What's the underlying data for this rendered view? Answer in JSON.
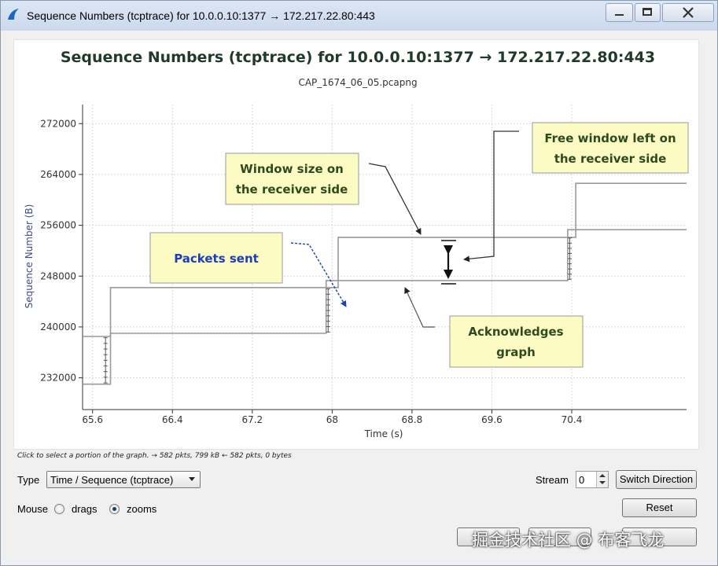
{
  "window": {
    "title": "Sequence Numbers (tcptrace) for 10.0.0.10:1377 → 172.217.22.80:443"
  },
  "chart_data": {
    "type": "line",
    "title": "Sequence Numbers (tcptrace) for 10.0.0.10:1377 → 172.217.22.80:443",
    "subtitle": "CAP_1674_06_05.pcapng",
    "xlabel": "Time (s)",
    "ylabel": "Sequence Number (B)",
    "xlim": [
      65.5,
      71.55
    ],
    "ylim": [
      227000,
      275000
    ],
    "xticks": [
      65.6,
      66.4,
      67.2,
      68,
      68.8,
      69.6,
      70.4
    ],
    "xtick_labels": [
      "65.6",
      "66.4",
      "67.2",
      "68",
      "68.8",
      "69.6",
      "70.4"
    ],
    "yticks": [
      232000,
      240000,
      248000,
      256000,
      264000,
      272000
    ],
    "ytick_labels": [
      "232000",
      "240000",
      "248000",
      "256000",
      "264000",
      "272000"
    ],
    "grid": true,
    "series": [
      {
        "color": "#9a9a9a",
        "x": [
          65.5,
          65.78,
          65.78,
          67.94,
          67.94,
          70.36,
          70.36,
          71.55
        ],
        "y": [
          231000,
          231000,
          239000,
          239000,
          247300,
          247300,
          255300,
          255300
        ]
      },
      {
        "color": "#9a9a9a",
        "x": [
          65.5,
          65.78,
          65.78,
          68.06,
          68.06,
          70.44,
          70.44,
          71.55
        ],
        "y": [
          238500,
          238500,
          246200,
          246200,
          254100,
          254100,
          262600,
          262600
        ]
      }
    ],
    "packet_bursts": [
      {
        "x": 65.73,
        "y0": 231200,
        "y1": 238300
      },
      {
        "x": 67.96,
        "y0": 239200,
        "y1": 246000
      },
      {
        "x": 70.38,
        "y0": 247500,
        "y1": 254000
      }
    ],
    "annotations": [
      {
        "text": "Window  size on\nthe receiver side"
      },
      {
        "text": "Free window  left on\nthe receiver side"
      },
      {
        "text": "Packets sent"
      },
      {
        "text": "Acknowledges\ngraph"
      }
    ]
  },
  "status": {
    "text": "Click to select a portion of the graph. → 582 pkts, 799 kB ← 582 pkts, 0 bytes"
  },
  "controls": {
    "type_label": "Type",
    "type_value": "Time / Sequence (tcptrace)",
    "stream_label": "Stream",
    "stream_value": "0",
    "switch_direction": "Switch Direction",
    "mouse_label": "Mouse",
    "drags_label": "drags",
    "zooms_label": "zooms",
    "reset": "Reset"
  },
  "watermark": {
    "text": "掘金技术社区 @ 布客飞龙"
  }
}
